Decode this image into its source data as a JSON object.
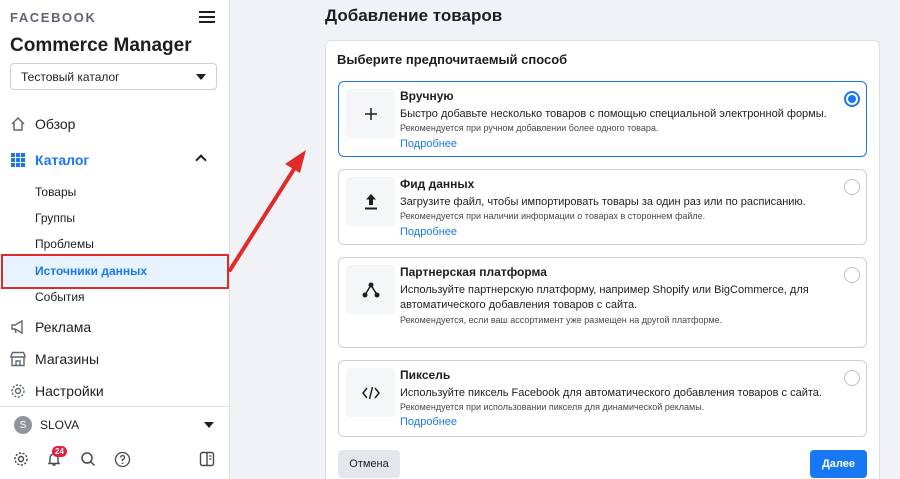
{
  "sidebar": {
    "brand": "FACEBOOK",
    "app_title": "Commerce Manager",
    "catalog_selector": {
      "value": "Тестовый каталог"
    },
    "nav": {
      "overview": "Обзор",
      "catalog": "Каталог",
      "ads": "Реклама",
      "shops": "Магазины",
      "settings": "Настройки"
    },
    "catalog_sub": {
      "products": "Товары",
      "groups": "Группы",
      "problems": "Проблемы",
      "data_sources": "Источники данных",
      "events": "События"
    },
    "account": {
      "avatar_letter": "S",
      "name": "SLOVA"
    },
    "notifications_count": "24"
  },
  "main": {
    "title": "Добавление товаров",
    "heading": "Выберите предпочитаемый способ",
    "options": [
      {
        "title": "Вручную",
        "description": "Быстро добавьте несколько товаров с помощью специальной электронной формы.",
        "note": "Рекомендуется при ручном добавлении более одного товара.",
        "link": "Подробнее",
        "icon": "plus-icon",
        "selected": true
      },
      {
        "title": "Фид данных",
        "description": "Загрузите файл, чтобы импортировать товары за один раз или по расписанию.",
        "note": "Рекомендуется при наличии информации о товарах в стороннем файле.",
        "link": "Подробнее",
        "icon": "upload-icon",
        "selected": false
      },
      {
        "title": "Партнерская платформа",
        "description": "Используйте партнерскую платформу, например Shopify или BigCommerce, для автоматического добавления товаров с сайта.",
        "note": "Рекомендуется, если ваш ассортимент уже размещен на другой платформе.",
        "icon": "share-nodes-icon",
        "selected": false
      },
      {
        "title": "Пиксель",
        "description": "Используйте пиксель Facebook для автоматического добавления товаров с сайта.",
        "note": "Рекомендуется при использовании пикселя для динамической рекламы.",
        "link": "Подробнее",
        "icon": "code-icon",
        "selected": false
      }
    ],
    "cancel_label": "Отмена",
    "next_label": "Далее"
  },
  "colors": {
    "accent": "#1877f2",
    "annotation": "#e12b2b"
  }
}
